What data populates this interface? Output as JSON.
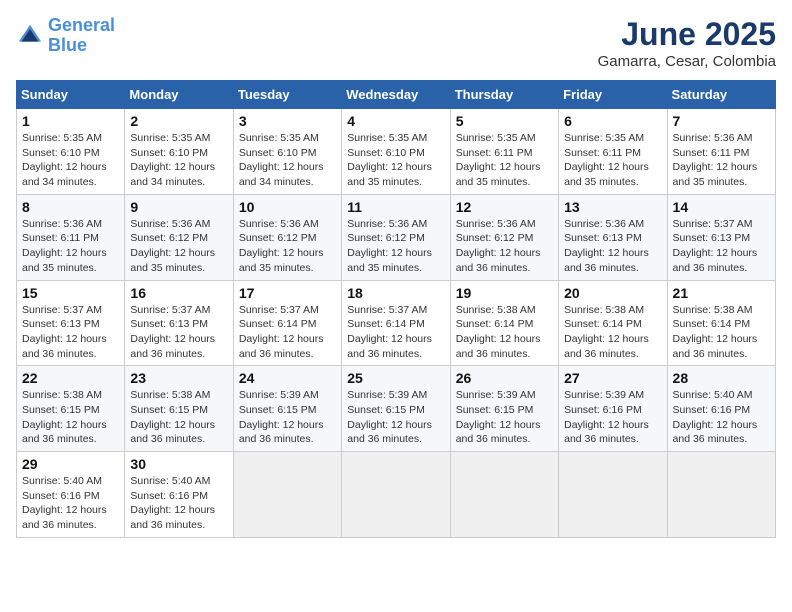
{
  "logo": {
    "line1": "General",
    "line2": "Blue"
  },
  "title": "June 2025",
  "subtitle": "Gamarra, Cesar, Colombia",
  "days_header": [
    "Sunday",
    "Monday",
    "Tuesday",
    "Wednesday",
    "Thursday",
    "Friday",
    "Saturday"
  ],
  "weeks": [
    [
      {
        "num": "1",
        "info": "Sunrise: 5:35 AM\nSunset: 6:10 PM\nDaylight: 12 hours\nand 34 minutes."
      },
      {
        "num": "2",
        "info": "Sunrise: 5:35 AM\nSunset: 6:10 PM\nDaylight: 12 hours\nand 34 minutes."
      },
      {
        "num": "3",
        "info": "Sunrise: 5:35 AM\nSunset: 6:10 PM\nDaylight: 12 hours\nand 34 minutes."
      },
      {
        "num": "4",
        "info": "Sunrise: 5:35 AM\nSunset: 6:10 PM\nDaylight: 12 hours\nand 35 minutes."
      },
      {
        "num": "5",
        "info": "Sunrise: 5:35 AM\nSunset: 6:11 PM\nDaylight: 12 hours\nand 35 minutes."
      },
      {
        "num": "6",
        "info": "Sunrise: 5:35 AM\nSunset: 6:11 PM\nDaylight: 12 hours\nand 35 minutes."
      },
      {
        "num": "7",
        "info": "Sunrise: 5:36 AM\nSunset: 6:11 PM\nDaylight: 12 hours\nand 35 minutes."
      }
    ],
    [
      {
        "num": "8",
        "info": "Sunrise: 5:36 AM\nSunset: 6:11 PM\nDaylight: 12 hours\nand 35 minutes."
      },
      {
        "num": "9",
        "info": "Sunrise: 5:36 AM\nSunset: 6:12 PM\nDaylight: 12 hours\nand 35 minutes."
      },
      {
        "num": "10",
        "info": "Sunrise: 5:36 AM\nSunset: 6:12 PM\nDaylight: 12 hours\nand 35 minutes."
      },
      {
        "num": "11",
        "info": "Sunrise: 5:36 AM\nSunset: 6:12 PM\nDaylight: 12 hours\nand 35 minutes."
      },
      {
        "num": "12",
        "info": "Sunrise: 5:36 AM\nSunset: 6:12 PM\nDaylight: 12 hours\nand 36 minutes."
      },
      {
        "num": "13",
        "info": "Sunrise: 5:36 AM\nSunset: 6:13 PM\nDaylight: 12 hours\nand 36 minutes."
      },
      {
        "num": "14",
        "info": "Sunrise: 5:37 AM\nSunset: 6:13 PM\nDaylight: 12 hours\nand 36 minutes."
      }
    ],
    [
      {
        "num": "15",
        "info": "Sunrise: 5:37 AM\nSunset: 6:13 PM\nDaylight: 12 hours\nand 36 minutes."
      },
      {
        "num": "16",
        "info": "Sunrise: 5:37 AM\nSunset: 6:13 PM\nDaylight: 12 hours\nand 36 minutes."
      },
      {
        "num": "17",
        "info": "Sunrise: 5:37 AM\nSunset: 6:14 PM\nDaylight: 12 hours\nand 36 minutes."
      },
      {
        "num": "18",
        "info": "Sunrise: 5:37 AM\nSunset: 6:14 PM\nDaylight: 12 hours\nand 36 minutes."
      },
      {
        "num": "19",
        "info": "Sunrise: 5:38 AM\nSunset: 6:14 PM\nDaylight: 12 hours\nand 36 minutes."
      },
      {
        "num": "20",
        "info": "Sunrise: 5:38 AM\nSunset: 6:14 PM\nDaylight: 12 hours\nand 36 minutes."
      },
      {
        "num": "21",
        "info": "Sunrise: 5:38 AM\nSunset: 6:14 PM\nDaylight: 12 hours\nand 36 minutes."
      }
    ],
    [
      {
        "num": "22",
        "info": "Sunrise: 5:38 AM\nSunset: 6:15 PM\nDaylight: 12 hours\nand 36 minutes."
      },
      {
        "num": "23",
        "info": "Sunrise: 5:38 AM\nSunset: 6:15 PM\nDaylight: 12 hours\nand 36 minutes."
      },
      {
        "num": "24",
        "info": "Sunrise: 5:39 AM\nSunset: 6:15 PM\nDaylight: 12 hours\nand 36 minutes."
      },
      {
        "num": "25",
        "info": "Sunrise: 5:39 AM\nSunset: 6:15 PM\nDaylight: 12 hours\nand 36 minutes."
      },
      {
        "num": "26",
        "info": "Sunrise: 5:39 AM\nSunset: 6:15 PM\nDaylight: 12 hours\nand 36 minutes."
      },
      {
        "num": "27",
        "info": "Sunrise: 5:39 AM\nSunset: 6:16 PM\nDaylight: 12 hours\nand 36 minutes."
      },
      {
        "num": "28",
        "info": "Sunrise: 5:40 AM\nSunset: 6:16 PM\nDaylight: 12 hours\nand 36 minutes."
      }
    ],
    [
      {
        "num": "29",
        "info": "Sunrise: 5:40 AM\nSunset: 6:16 PM\nDaylight: 12 hours\nand 36 minutes."
      },
      {
        "num": "30",
        "info": "Sunrise: 5:40 AM\nSunset: 6:16 PM\nDaylight: 12 hours\nand 36 minutes."
      },
      {
        "num": "",
        "info": ""
      },
      {
        "num": "",
        "info": ""
      },
      {
        "num": "",
        "info": ""
      },
      {
        "num": "",
        "info": ""
      },
      {
        "num": "",
        "info": ""
      }
    ]
  ]
}
